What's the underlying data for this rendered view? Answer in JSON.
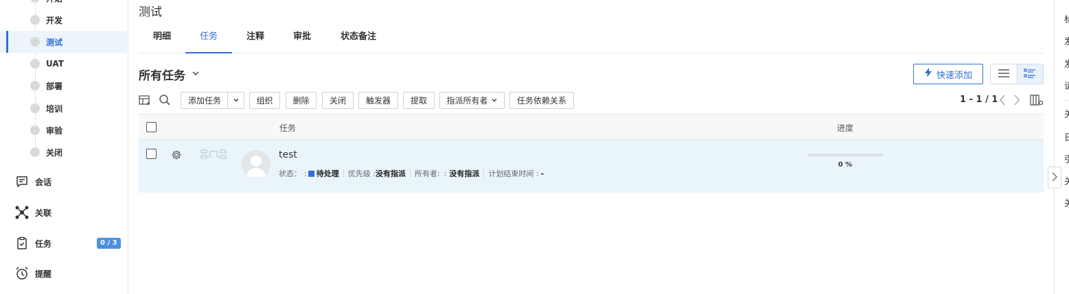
{
  "sidebar": {
    "stages": [
      {
        "label": "开始",
        "active": false
      },
      {
        "label": "开发",
        "active": false
      },
      {
        "label": "测试",
        "active": true
      },
      {
        "label": "UAT",
        "active": false
      },
      {
        "label": "部署",
        "active": false
      },
      {
        "label": "培训",
        "active": false
      },
      {
        "label": "审验",
        "active": false
      },
      {
        "label": "关闭",
        "active": false
      }
    ],
    "nav": [
      {
        "label": "会话",
        "icon": "chat-icon"
      },
      {
        "label": "关联",
        "icon": "network-icon"
      },
      {
        "label": "任务",
        "icon": "clipboard-icon",
        "badge": "0 / 3"
      },
      {
        "label": "提醒",
        "icon": "alarm-clock-icon"
      }
    ]
  },
  "main": {
    "title": "测试",
    "tabs": [
      {
        "label": "明细",
        "active": false
      },
      {
        "label": "任务",
        "active": true
      },
      {
        "label": "注释",
        "active": false
      },
      {
        "label": "审批",
        "active": false
      },
      {
        "label": "状态备注",
        "active": false
      }
    ],
    "section_title": "所有任务",
    "quick_add_label": "快速添加",
    "toolbar": {
      "add_task": "添加任务",
      "organize": "组织",
      "delete": "删除",
      "close": "关闭",
      "trigger": "触发器",
      "fetch": "提取",
      "assign_owner": "指派所有者",
      "dependencies": "任务依赖关系",
      "pager": "1 - 1 / 1"
    },
    "table": {
      "headers": {
        "task": "任务",
        "progress": "进度"
      },
      "rows": [
        {
          "name": "test",
          "status_label": "状态：",
          "status_value": "待处理",
          "priority_label": "优先级 :",
          "priority_value": "没有指派",
          "owner_label": "所有者:",
          "owner_value": "没有指派",
          "end_label": "计划结束时间 :",
          "end_value": "-",
          "progress": 0,
          "progress_text": "0 %"
        }
      ]
    }
  },
  "right_panel": {
    "items": [
      "标",
      "发",
      "发",
      "请",
      "关",
      "日",
      "引",
      "关",
      "关"
    ]
  },
  "colors": {
    "accent": "#2f6fd6",
    "badge": "#4a90e2",
    "row_highlight": "#eaf4fb"
  }
}
